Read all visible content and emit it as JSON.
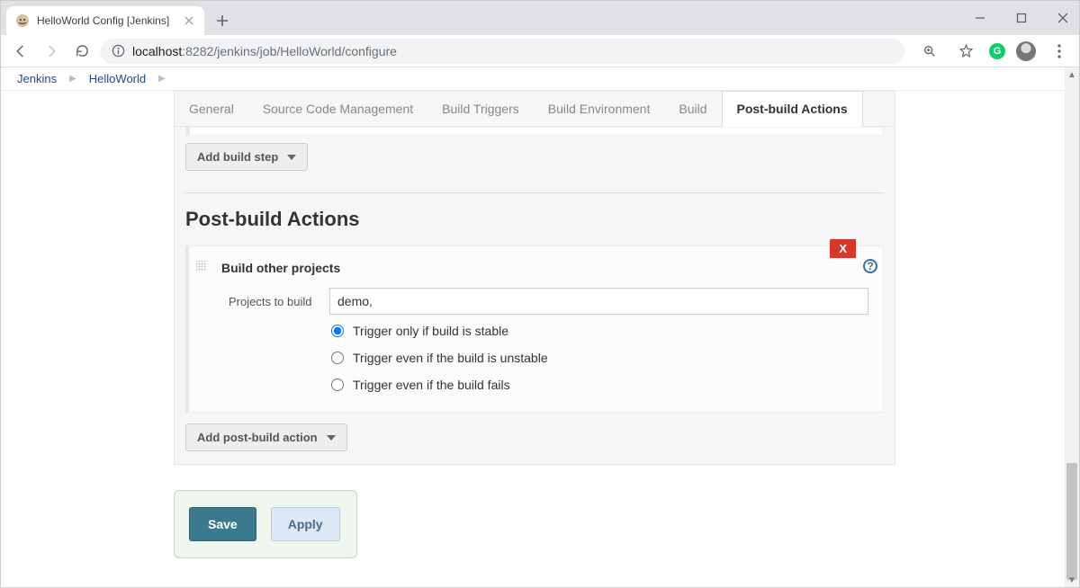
{
  "browser": {
    "tab_title": "HelloWorld Config [Jenkins]",
    "url_host": "localhost",
    "url_port": ":8282",
    "url_path": "/jenkins/job/HelloWorld/configure"
  },
  "breadcrumbs": {
    "root": "Jenkins",
    "project": "HelloWorld"
  },
  "tabs": {
    "general": "General",
    "scm": "Source Code Management",
    "triggers": "Build Triggers",
    "env": "Build Environment",
    "build": "Build",
    "post": "Post-build Actions"
  },
  "buttons": {
    "add_build_step": "Add build step",
    "add_post_build_action": "Add post-build action",
    "save": "Save",
    "apply": "Apply",
    "delete_card": "X"
  },
  "section": {
    "title": "Post-build Actions"
  },
  "card": {
    "title": "Build other projects",
    "projects_label": "Projects to build",
    "projects_value": "demo,",
    "radio_stable": "Trigger only if build is stable",
    "radio_unstable": "Trigger even if the build is unstable",
    "radio_fails": "Trigger even if the build fails",
    "help_glyph": "?"
  }
}
